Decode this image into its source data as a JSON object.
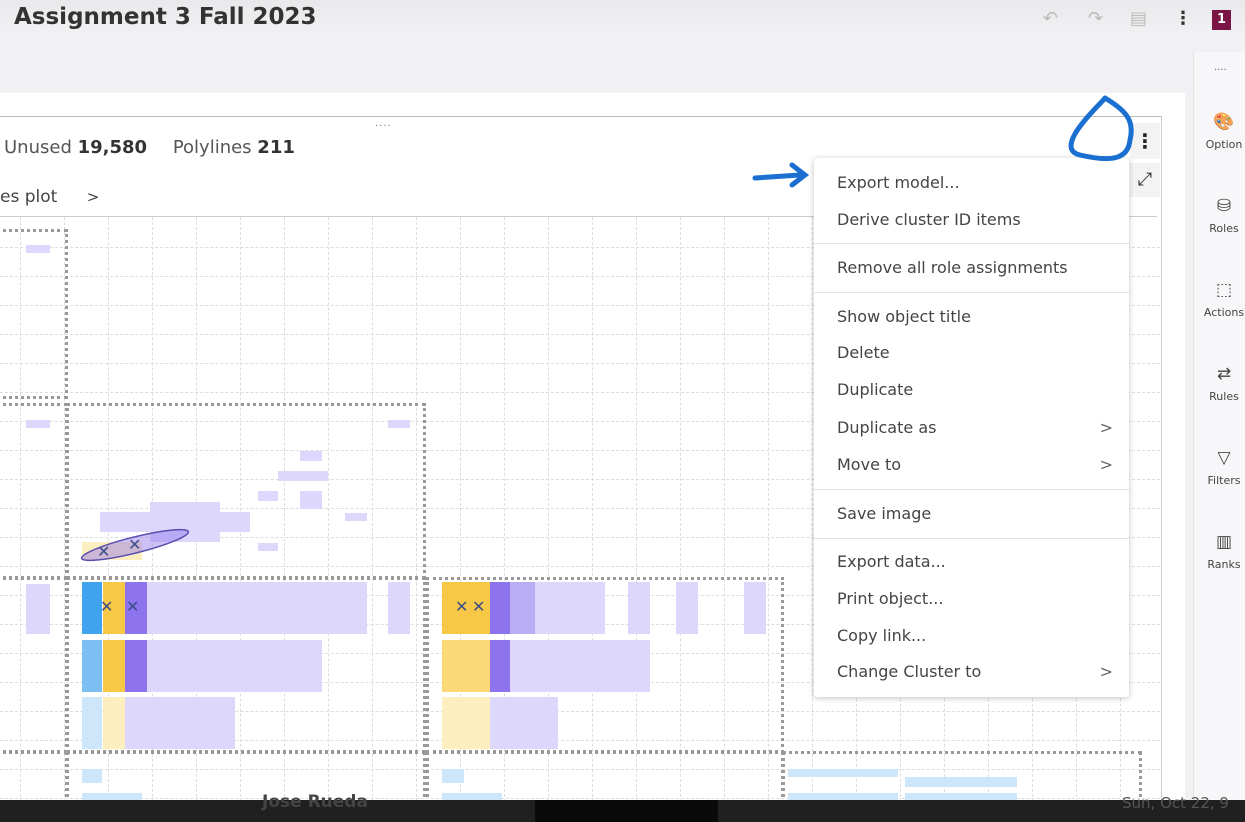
{
  "header": {
    "title": "Assignment 3 Fall 2023",
    "badge": "1",
    "undo": "↶",
    "redo": "↷",
    "save": "▤",
    "more": "⋮"
  },
  "object": {
    "handle": "....",
    "unused_label": "Unused",
    "unused_value": "19,580",
    "polylines_label": "Polylines",
    "polylines_value": "211",
    "breadcrumb": "es plot",
    "breadcrumb_chevron": ">",
    "kebab": "⋮",
    "expand": "⤢"
  },
  "sidebar": {
    "handle": "....",
    "items": [
      {
        "label": "Option",
        "icon": "palette-icon",
        "glyph": "🎨"
      },
      {
        "label": "Roles",
        "icon": "database-icon",
        "glyph": "⛁"
      },
      {
        "label": "Actions",
        "icon": "cursor-select-icon",
        "glyph": "⬚"
      },
      {
        "label": "Rules",
        "icon": "rules-icon",
        "glyph": "⇄"
      },
      {
        "label": "Filters",
        "icon": "filter-icon",
        "glyph": "▽"
      },
      {
        "label": "Ranks",
        "icon": "ranks-icon",
        "glyph": "▥"
      }
    ]
  },
  "menu": {
    "items": [
      {
        "label": "Export model..."
      },
      {
        "label": "Derive cluster ID items"
      },
      {
        "label": "Remove all role assignments"
      },
      {
        "label": "Show object title"
      },
      {
        "label": "Delete"
      },
      {
        "label": "Duplicate"
      },
      {
        "label": "Duplicate as",
        "submenu": ">"
      },
      {
        "label": "Move to",
        "submenu": ">"
      },
      {
        "label": "Save image"
      },
      {
        "label": "Export data..."
      },
      {
        "label": "Print object..."
      },
      {
        "label": "Copy link..."
      },
      {
        "label": "Change Cluster to",
        "submenu": ">"
      }
    ]
  },
  "bottom": {
    "name": "Jose Rueda",
    "date": "Sun, Oct 22, 9"
  },
  "colors": {
    "annotation": "#1a6fd1",
    "badge": "#7a1546",
    "purple": "#cfc7f7",
    "blue": "#3fa3ee",
    "yellow": "#f7c845"
  }
}
